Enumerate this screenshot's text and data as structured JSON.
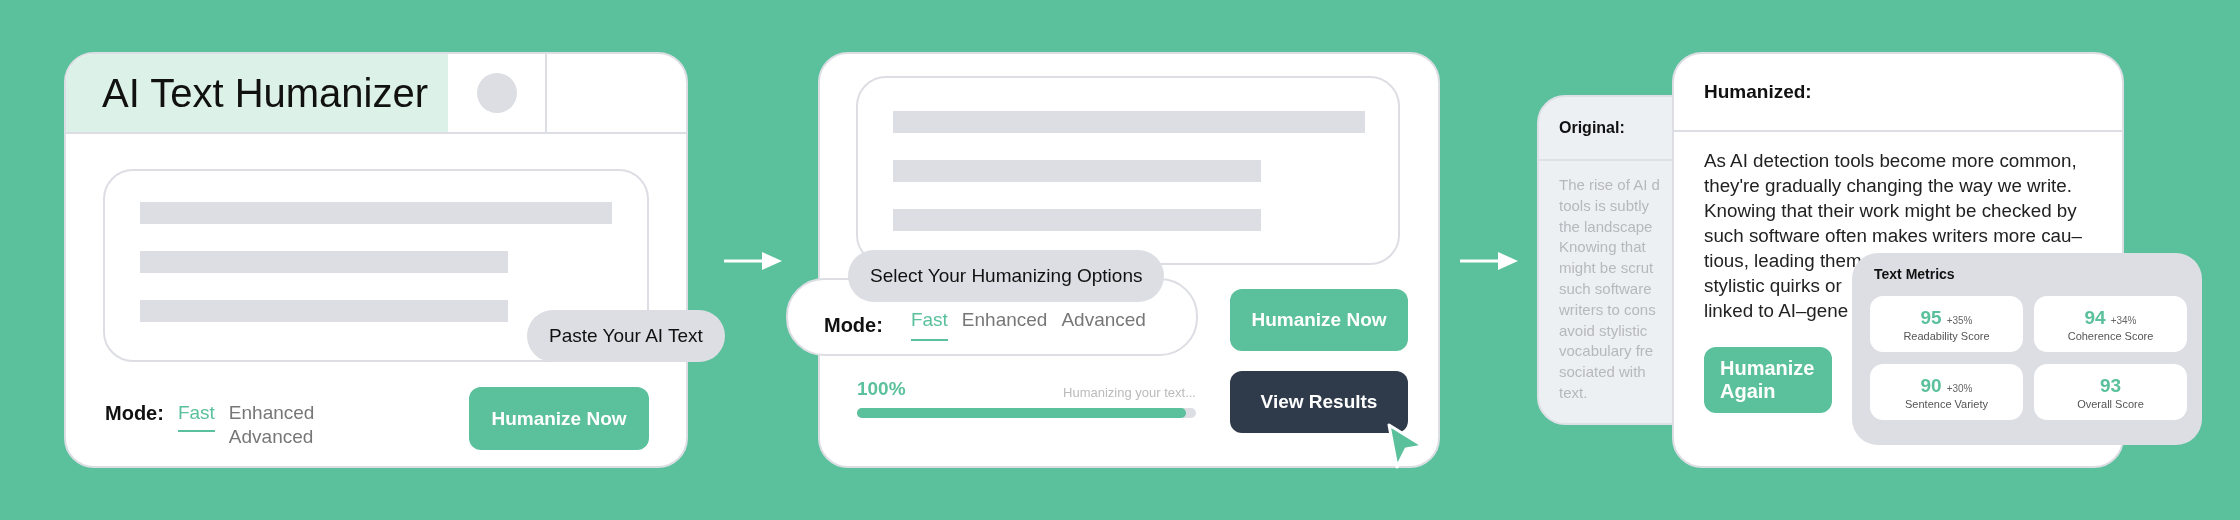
{
  "input_panel": {
    "title": "AI Text Humanizer",
    "hint": "Paste Your AI Text",
    "mode_label": "Mode:",
    "modes": [
      {
        "label": "Fast",
        "selected": true
      },
      {
        "label": "Enhanced",
        "selected": false
      },
      {
        "label": "Advanced",
        "selected": false
      }
    ],
    "button": "Humanize Now"
  },
  "options_panel": {
    "hint": "Select Your Humanizing Options",
    "mode_label": "Mode:",
    "modes": [
      {
        "label": "Fast",
        "selected": true
      },
      {
        "label": "Enhanced",
        "selected": false
      },
      {
        "label": "Advanced",
        "selected": false
      }
    ],
    "button": "Humanize Now",
    "progress": {
      "reading": "100%",
      "status": "Humanizing your text...",
      "level": 0.97
    },
    "results_button": "View Results"
  },
  "results_panel": {
    "original": {
      "title": "Original:",
      "lines": [
        "The rise of AI d",
        "tools is subtly",
        "the landscape",
        "Knowing that",
        "might be scrut",
        "such software",
        "writers to cons",
        "avoid stylistic",
        "vocabulary fre",
        "sociated with",
        "text."
      ]
    },
    "humanized": {
      "title": "Humanized:",
      "lines": [
        "As AI detection tools become more common,",
        "they're gradually changing the way we write.",
        "Knowing that their work might be checked by",
        "such software often makes writers more cau–",
        "tious, leading them",
        "stylistic quirks or",
        "linked to AI–gene"
      ]
    },
    "button": "Humanize Again",
    "metrics": {
      "title": "Text Metrics",
      "items": [
        {
          "value": "95",
          "change": "+35%",
          "label": "Readability Score"
        },
        {
          "value": "94",
          "change": "+34%",
          "label": "Coherence Score"
        },
        {
          "value": "90",
          "change": "+30%",
          "label": "Sentence Variety"
        },
        {
          "value": "93",
          "label": "Overall Score"
        }
      ]
    }
  }
}
